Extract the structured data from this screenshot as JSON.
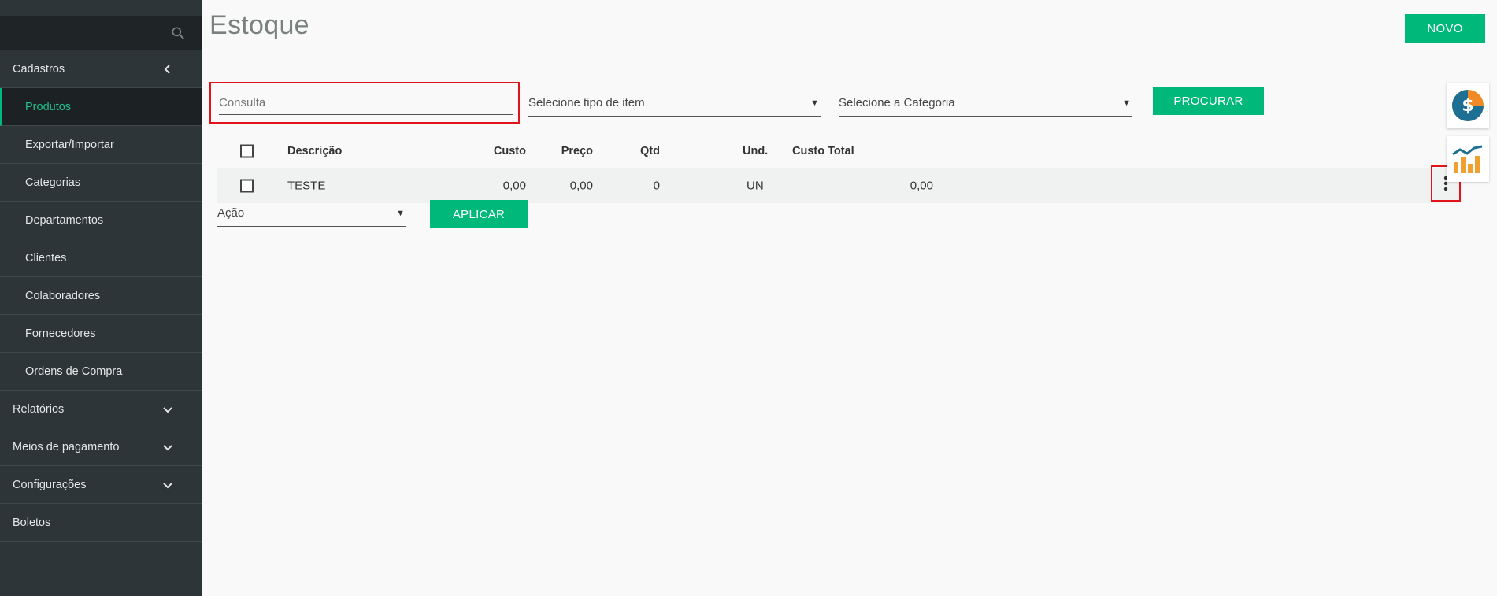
{
  "sidebar": {
    "section_open": "Cadastros",
    "items": [
      {
        "label": "Produtos"
      },
      {
        "label": "Exportar/Importar"
      },
      {
        "label": "Categorias"
      },
      {
        "label": "Departamentos"
      },
      {
        "label": "Clientes"
      },
      {
        "label": "Colaboradores"
      },
      {
        "label": "Fornecedores"
      },
      {
        "label": "Ordens de Compra"
      }
    ],
    "sections": [
      {
        "label": "Relatórios"
      },
      {
        "label": "Meios de pagamento"
      },
      {
        "label": "Configurações"
      },
      {
        "label": "Boletos"
      }
    ]
  },
  "header": {
    "title": "Estoque",
    "novo_label": "NOVO"
  },
  "filters": {
    "search_placeholder": "Consulta",
    "tipo_placeholder": "Selecione tipo de item",
    "categoria_placeholder": "Selecione a Categoria",
    "procurar_label": "PROCURAR"
  },
  "table": {
    "columns": {
      "descricao": "Descrição",
      "custo": "Custo",
      "preco": "Preço",
      "qtd": "Qtd",
      "und": "Und.",
      "custo_total": "Custo Total"
    },
    "rows": [
      {
        "descricao": "TESTE",
        "custo": "0,00",
        "preco": "0,00",
        "qtd": "0",
        "und": "UN",
        "custo_total": "0,00"
      }
    ]
  },
  "actions": {
    "acao_placeholder": "Ação",
    "aplicar_label": "APLICAR"
  },
  "icons": {
    "search": "search-icon",
    "money": "dollar-coin-icon",
    "chart": "bar-chart-icon",
    "kebab": "more-vertical-icon"
  },
  "colors": {
    "accent": "#00b87a",
    "sidebar": "#2d3538",
    "highlight": "#e0141a"
  }
}
